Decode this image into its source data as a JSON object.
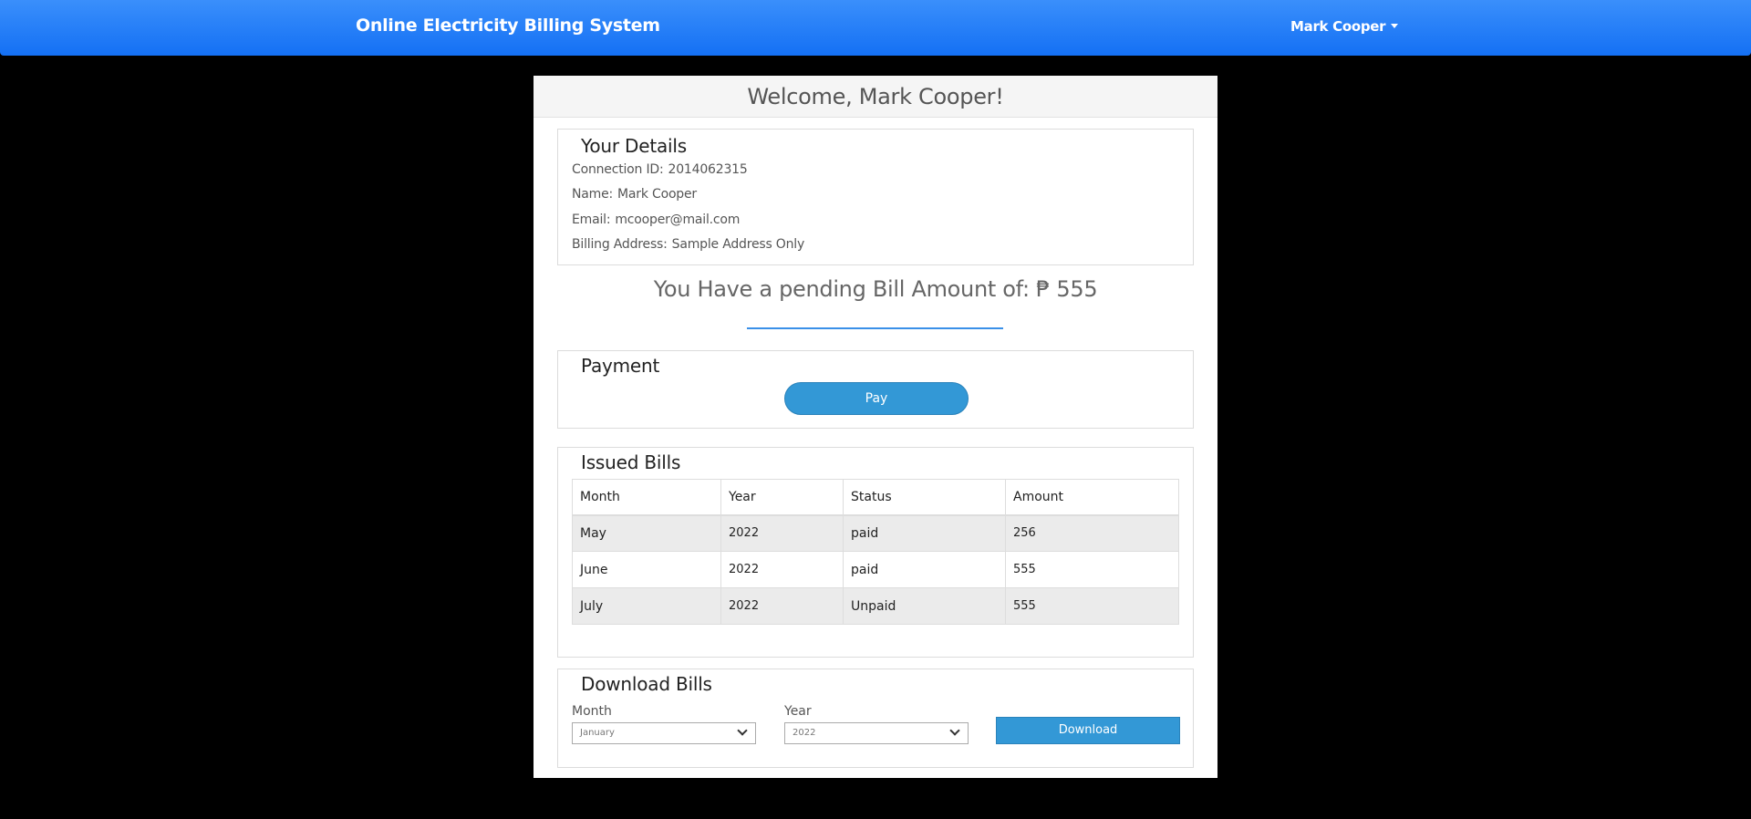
{
  "navbar": {
    "brand": "Online Electricity Billing System",
    "user": "Mark Cooper"
  },
  "welcome": "Welcome, Mark Cooper!",
  "details": {
    "title": "Your Details",
    "connection_label": "Connection ID:",
    "connection_id": "2014062315",
    "name_label": "Name:",
    "name": "Mark Cooper",
    "email_label": "Email:",
    "email": "mcooper@mail.com",
    "address_label": "Billing Address:",
    "address": "Sample Address Only"
  },
  "pending": "You Have a pending Bill Amount of: ₱ 555",
  "payment": {
    "title": "Payment",
    "pay_label": "Pay"
  },
  "bills": {
    "title": "Issued Bills",
    "headers": [
      "Month",
      "Year",
      "Status",
      "Amount"
    ],
    "rows": [
      [
        "May",
        "2022",
        "paid",
        "256"
      ],
      [
        "June",
        "2022",
        "paid",
        "555"
      ],
      [
        "July",
        "2022",
        "Unpaid",
        "555"
      ]
    ]
  },
  "download": {
    "title": "Download Bills",
    "month_label": "Month",
    "month_value": "January",
    "year_label": "Year",
    "year_value": "2022",
    "button": "Download"
  },
  "colors": {
    "navbar": "#1a73f5",
    "button": "#3398d6",
    "accent_line": "#3a90e8"
  }
}
